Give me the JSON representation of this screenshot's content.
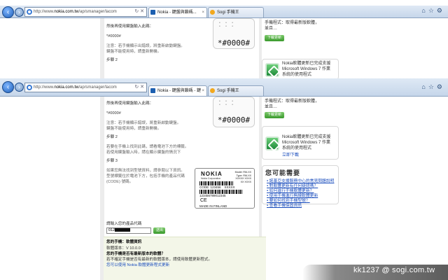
{
  "browser_top": {
    "address": {
      "prefix": "http://www.",
      "host": "nokia.com.tw",
      "path": "/ap/smanager/lacom"
    },
    "tabs": [
      {
        "label": "Nokia - 鍵盤與鎖碼...",
        "icon": "nokia-favicon"
      },
      {
        "label": "Sogi 手機王",
        "icon": "sogi-favicon"
      }
    ]
  },
  "browser_mid": {
    "address": {
      "prefix": "http://www.",
      "host": "nokia.com.tw",
      "path": "/ap/smanager/lacom"
    },
    "tabs": [
      {
        "label": "Nokia - 鍵盤與鎖碼 - 鍵",
        "icon": "nokia-favicon"
      },
      {
        "label": "Sogi 手機王",
        "icon": "sogi-favicon"
      }
    ]
  },
  "top_section": {
    "paragraphs": [
      "然後再使用鍵盤輸入此碼：",
      "*#0000#",
      "注意：若手機顯示出錯誤，將重新啟動鍵盤。",
      "鍵盤不能使用時，請重新開機。",
      "步驟 2"
    ],
    "phone_code": "*#0000#",
    "side_text": [
      "手機程式：取得最新版軟體，",
      "並且…"
    ],
    "side_btn": "下載更新",
    "side_box_text": [
      "Nokia軟體更新已完成支援",
      "Microsoft Windows 7 作業",
      "系統的使用程式"
    ]
  },
  "mid_section": {
    "paragraphs": [
      "然後再使用鍵盤輸入此碼：",
      "*#0000#",
      "注意：若手機顯示錯誤，將重新啟動鍵盤。",
      "鍵盤不能使用時，請重新開機。",
      "步驟 2",
      "若要在手機上找到此碼，請看電池下方的標籤。",
      "若使用鍵盤輸入時，請在顯示鍵盤的情況下",
      "步驟 3",
      "如果您無法找到型號資料，請參閱以下資訊。",
      "型號標籤位於電池下方，包括手機的產品代碼",
      "(CODE) 號碼。"
    ],
    "phone_code": "*#0000#",
    "side_text": [
      "手機程式：取得最新版軟體，",
      "並且…"
    ],
    "side_btn": "下載更新",
    "side_box_text": [
      "Nokia軟體更新已完成支援",
      "Microsoft Windows 7 作業",
      "系統的使用程式"
    ],
    "side_link": "立即下載",
    "related_title": "您可能需要",
    "related_links": [
      "諾基亞支援服務中心的常見問題說明",
      "對軟體更新有任何疑問嗎？",
      "如何進行手機軟體更新？",
      "使用手機進行無線軟體更新",
      "要如何找到手機型號？",
      "查看手機保固資訊"
    ],
    "label": {
      "brand": "NOKIA",
      "corp": "Nokia Corporation",
      "spec": "Model: RM-XX\nType: RM-XX\nXXXXX XXXX\nXX XXXX",
      "code": "CODE: 123456    XXXXX",
      "imei": "123456789012345",
      "origin": "MADE IN FINLAND",
      "ce": "CE"
    },
    "input_prompt": "請輸入您的產品代碼",
    "input_value": "012",
    "input_btn": "送出",
    "info": {
      "title": "您的手機：軟體資訊",
      "lines": [
        "軟體版本：V 10.0.0",
        "您的手機是否有最新版本的軟體？",
        "若不確定手機是否有最新的軟體版本，請使用軟體更新程式。",
        "您可以使用 Nokia 軟體更新程式更新"
      ]
    }
  },
  "watermark": {
    "user": "kk1237",
    "at": "@",
    "site": "sogi.com.tw"
  }
}
